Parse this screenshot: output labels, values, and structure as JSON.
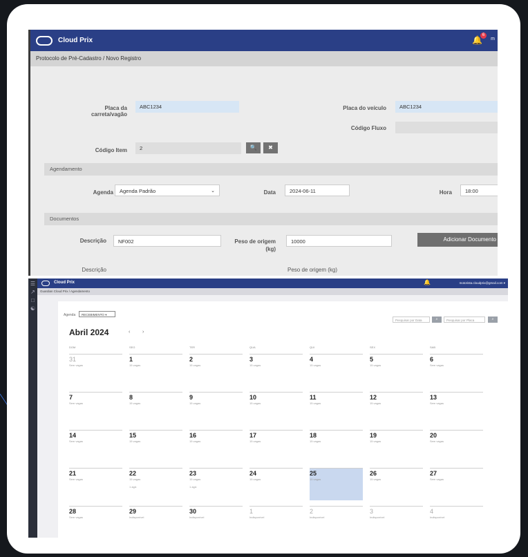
{
  "shot1": {
    "app_title": "Cloud Prix",
    "notification_count": "6",
    "user_initial": "m",
    "breadcrumb": "Protocolo de Pré-Cadastro  /  Novo Registro",
    "form": {
      "placa_carreta_label": "Placa da carreta/vagão",
      "placa_carreta_value": "ABC1234",
      "placa_veiculo_label": "Placa do veículo",
      "placa_veiculo_value": "ABC1234",
      "codigo_fluxo_label": "Código Fluxo",
      "codigo_fluxo_value": "",
      "codigo_item_label": "Código Item",
      "codigo_item_value": "2",
      "search_icon": "🔍",
      "clear_icon": "✖"
    },
    "agendamento": {
      "section_label": "Agendamento",
      "agenda_label": "Agenda",
      "agenda_value": "Agenda Padrão",
      "data_label": "Data",
      "data_value": "2024-06-11",
      "hora_label": "Hora",
      "hora_value": "18:00"
    },
    "documentos": {
      "section_label": "Documentos",
      "descricao_label": "Descrição",
      "descricao_value": "NF002",
      "peso_label": "Peso de origem (kg)",
      "peso_value": "10000",
      "add_button": "Adicionar Documento",
      "col_descricao": "Descrição",
      "col_peso": "Peso de origem (kg)"
    }
  },
  "shot2": {
    "app_title": "Cloud Prix",
    "user_email": "motorista.cloudprix@gmail.com ▾",
    "breadcrumb": "Guardian Cloud Prix  /  Agendamento",
    "agenda_label": "Agenda",
    "agenda_select": "RECEBIMENTO",
    "search_date_placeholder": "Pesquisar por Data",
    "search_plate_placeholder": "Pesquisar por Placa",
    "month_title": "Abril 2024",
    "prev": "‹",
    "next": "›",
    "days": [
      "DOM",
      "SEG",
      "TER",
      "QUA",
      "QUI",
      "SEX",
      "SAB"
    ],
    "weeks": [
      [
        {
          "n": "31",
          "s": "Sem vagas",
          "out": true
        },
        {
          "n": "1",
          "s": "15 vagas"
        },
        {
          "n": "2",
          "s": "15 vagas"
        },
        {
          "n": "3",
          "s": "15 vagas"
        },
        {
          "n": "4",
          "s": "15 vagas"
        },
        {
          "n": "5",
          "s": "15 vagas"
        },
        {
          "n": "6",
          "s": "Sem vagas"
        }
      ],
      [
        {
          "n": "7",
          "s": "Sem vagas"
        },
        {
          "n": "8",
          "s": "15 vagas"
        },
        {
          "n": "9",
          "s": "15 vagas"
        },
        {
          "n": "10",
          "s": "15 vagas"
        },
        {
          "n": "11",
          "s": "15 vagas"
        },
        {
          "n": "12",
          "s": "15 vagas"
        },
        {
          "n": "13",
          "s": "Sem vagas"
        }
      ],
      [
        {
          "n": "14",
          "s": "Sem vagas"
        },
        {
          "n": "15",
          "s": "15 vagas"
        },
        {
          "n": "16",
          "s": "15 vagas"
        },
        {
          "n": "17",
          "s": "15 vagas"
        },
        {
          "n": "18",
          "s": "15 vagas"
        },
        {
          "n": "19",
          "s": "15 vagas"
        },
        {
          "n": "20",
          "s": "Sem vagas"
        }
      ],
      [
        {
          "n": "21",
          "s": "Sem vagas"
        },
        {
          "n": "22",
          "s": "15 vagas",
          "s2": "1 agd."
        },
        {
          "n": "23",
          "s": "15 vagas",
          "s2": "1 agd."
        },
        {
          "n": "24",
          "s": "15 vagas"
        },
        {
          "n": "25",
          "s": "15 vagas",
          "hl": true
        },
        {
          "n": "26",
          "s": "15 vagas"
        },
        {
          "n": "27",
          "s": "Sem vagas"
        }
      ],
      [
        {
          "n": "28",
          "s": "Sem vagas"
        },
        {
          "n": "29",
          "s": "Indisponível"
        },
        {
          "n": "30",
          "s": "Indisponível"
        },
        {
          "n": "1",
          "s": "Indisponível",
          "out": true
        },
        {
          "n": "2",
          "s": "Indisponível",
          "out": true
        },
        {
          "n": "3",
          "s": "Indisponível",
          "out": true
        },
        {
          "n": "4",
          "s": "Indisponível",
          "out": true
        }
      ]
    ]
  }
}
